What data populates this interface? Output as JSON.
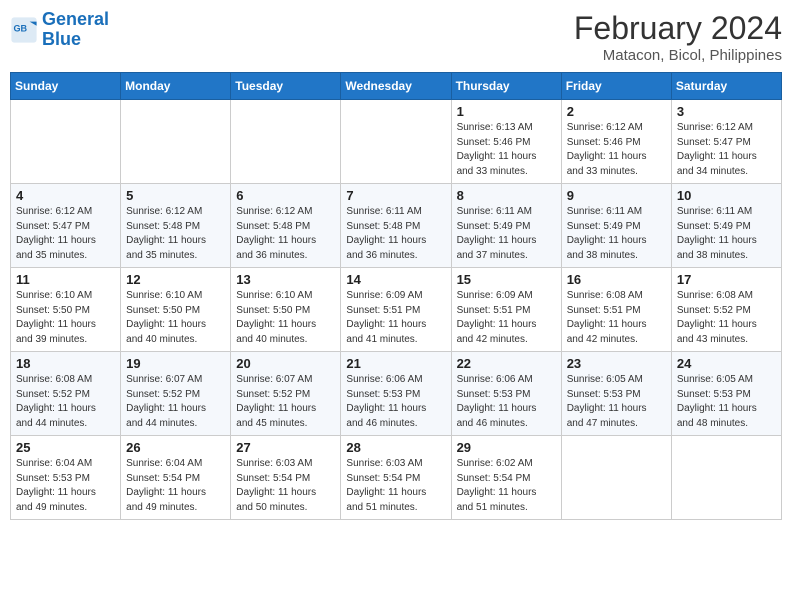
{
  "header": {
    "logo_line1": "General",
    "logo_line2": "Blue",
    "title": "February 2024",
    "subtitle": "Matacon, Bicol, Philippines"
  },
  "calendar": {
    "headers": [
      "Sunday",
      "Monday",
      "Tuesday",
      "Wednesday",
      "Thursday",
      "Friday",
      "Saturday"
    ],
    "weeks": [
      [
        {
          "day": "",
          "info": ""
        },
        {
          "day": "",
          "info": ""
        },
        {
          "day": "",
          "info": ""
        },
        {
          "day": "",
          "info": ""
        },
        {
          "day": "1",
          "info": "Sunrise: 6:13 AM\nSunset: 5:46 PM\nDaylight: 11 hours\nand 33 minutes."
        },
        {
          "day": "2",
          "info": "Sunrise: 6:12 AM\nSunset: 5:46 PM\nDaylight: 11 hours\nand 33 minutes."
        },
        {
          "day": "3",
          "info": "Sunrise: 6:12 AM\nSunset: 5:47 PM\nDaylight: 11 hours\nand 34 minutes."
        }
      ],
      [
        {
          "day": "4",
          "info": "Sunrise: 6:12 AM\nSunset: 5:47 PM\nDaylight: 11 hours\nand 35 minutes."
        },
        {
          "day": "5",
          "info": "Sunrise: 6:12 AM\nSunset: 5:48 PM\nDaylight: 11 hours\nand 35 minutes."
        },
        {
          "day": "6",
          "info": "Sunrise: 6:12 AM\nSunset: 5:48 PM\nDaylight: 11 hours\nand 36 minutes."
        },
        {
          "day": "7",
          "info": "Sunrise: 6:11 AM\nSunset: 5:48 PM\nDaylight: 11 hours\nand 36 minutes."
        },
        {
          "day": "8",
          "info": "Sunrise: 6:11 AM\nSunset: 5:49 PM\nDaylight: 11 hours\nand 37 minutes."
        },
        {
          "day": "9",
          "info": "Sunrise: 6:11 AM\nSunset: 5:49 PM\nDaylight: 11 hours\nand 38 minutes."
        },
        {
          "day": "10",
          "info": "Sunrise: 6:11 AM\nSunset: 5:49 PM\nDaylight: 11 hours\nand 38 minutes."
        }
      ],
      [
        {
          "day": "11",
          "info": "Sunrise: 6:10 AM\nSunset: 5:50 PM\nDaylight: 11 hours\nand 39 minutes."
        },
        {
          "day": "12",
          "info": "Sunrise: 6:10 AM\nSunset: 5:50 PM\nDaylight: 11 hours\nand 40 minutes."
        },
        {
          "day": "13",
          "info": "Sunrise: 6:10 AM\nSunset: 5:50 PM\nDaylight: 11 hours\nand 40 minutes."
        },
        {
          "day": "14",
          "info": "Sunrise: 6:09 AM\nSunset: 5:51 PM\nDaylight: 11 hours\nand 41 minutes."
        },
        {
          "day": "15",
          "info": "Sunrise: 6:09 AM\nSunset: 5:51 PM\nDaylight: 11 hours\nand 42 minutes."
        },
        {
          "day": "16",
          "info": "Sunrise: 6:08 AM\nSunset: 5:51 PM\nDaylight: 11 hours\nand 42 minutes."
        },
        {
          "day": "17",
          "info": "Sunrise: 6:08 AM\nSunset: 5:52 PM\nDaylight: 11 hours\nand 43 minutes."
        }
      ],
      [
        {
          "day": "18",
          "info": "Sunrise: 6:08 AM\nSunset: 5:52 PM\nDaylight: 11 hours\nand 44 minutes."
        },
        {
          "day": "19",
          "info": "Sunrise: 6:07 AM\nSunset: 5:52 PM\nDaylight: 11 hours\nand 44 minutes."
        },
        {
          "day": "20",
          "info": "Sunrise: 6:07 AM\nSunset: 5:52 PM\nDaylight: 11 hours\nand 45 minutes."
        },
        {
          "day": "21",
          "info": "Sunrise: 6:06 AM\nSunset: 5:53 PM\nDaylight: 11 hours\nand 46 minutes."
        },
        {
          "day": "22",
          "info": "Sunrise: 6:06 AM\nSunset: 5:53 PM\nDaylight: 11 hours\nand 46 minutes."
        },
        {
          "day": "23",
          "info": "Sunrise: 6:05 AM\nSunset: 5:53 PM\nDaylight: 11 hours\nand 47 minutes."
        },
        {
          "day": "24",
          "info": "Sunrise: 6:05 AM\nSunset: 5:53 PM\nDaylight: 11 hours\nand 48 minutes."
        }
      ],
      [
        {
          "day": "25",
          "info": "Sunrise: 6:04 AM\nSunset: 5:53 PM\nDaylight: 11 hours\nand 49 minutes."
        },
        {
          "day": "26",
          "info": "Sunrise: 6:04 AM\nSunset: 5:54 PM\nDaylight: 11 hours\nand 49 minutes."
        },
        {
          "day": "27",
          "info": "Sunrise: 6:03 AM\nSunset: 5:54 PM\nDaylight: 11 hours\nand 50 minutes."
        },
        {
          "day": "28",
          "info": "Sunrise: 6:03 AM\nSunset: 5:54 PM\nDaylight: 11 hours\nand 51 minutes."
        },
        {
          "day": "29",
          "info": "Sunrise: 6:02 AM\nSunset: 5:54 PM\nDaylight: 11 hours\nand 51 minutes."
        },
        {
          "day": "",
          "info": ""
        },
        {
          "day": "",
          "info": ""
        }
      ]
    ]
  }
}
